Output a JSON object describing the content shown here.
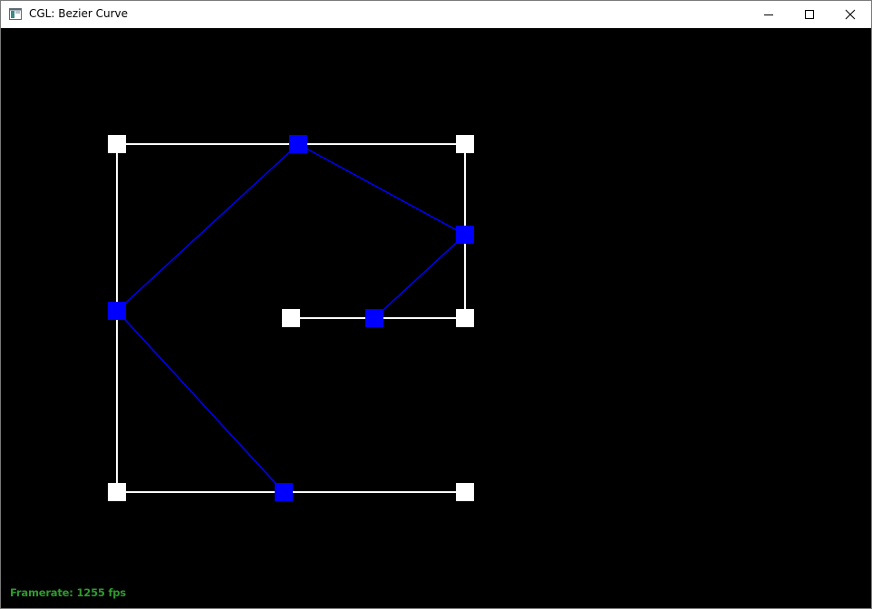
{
  "window": {
    "title": "CGL: Bezier Curve",
    "controls": {
      "minimize_icon": "minimize-icon",
      "maximize_icon": "maximize-icon",
      "close_icon": "close-icon"
    }
  },
  "canvas": {
    "background": "#000000",
    "control_point_color": "#ffffff",
    "evaluated_point_color": "#0000ff"
  },
  "status": {
    "framerate_text": "Framerate: 1255 fps",
    "framerate_color": "#2f9a2f"
  }
}
